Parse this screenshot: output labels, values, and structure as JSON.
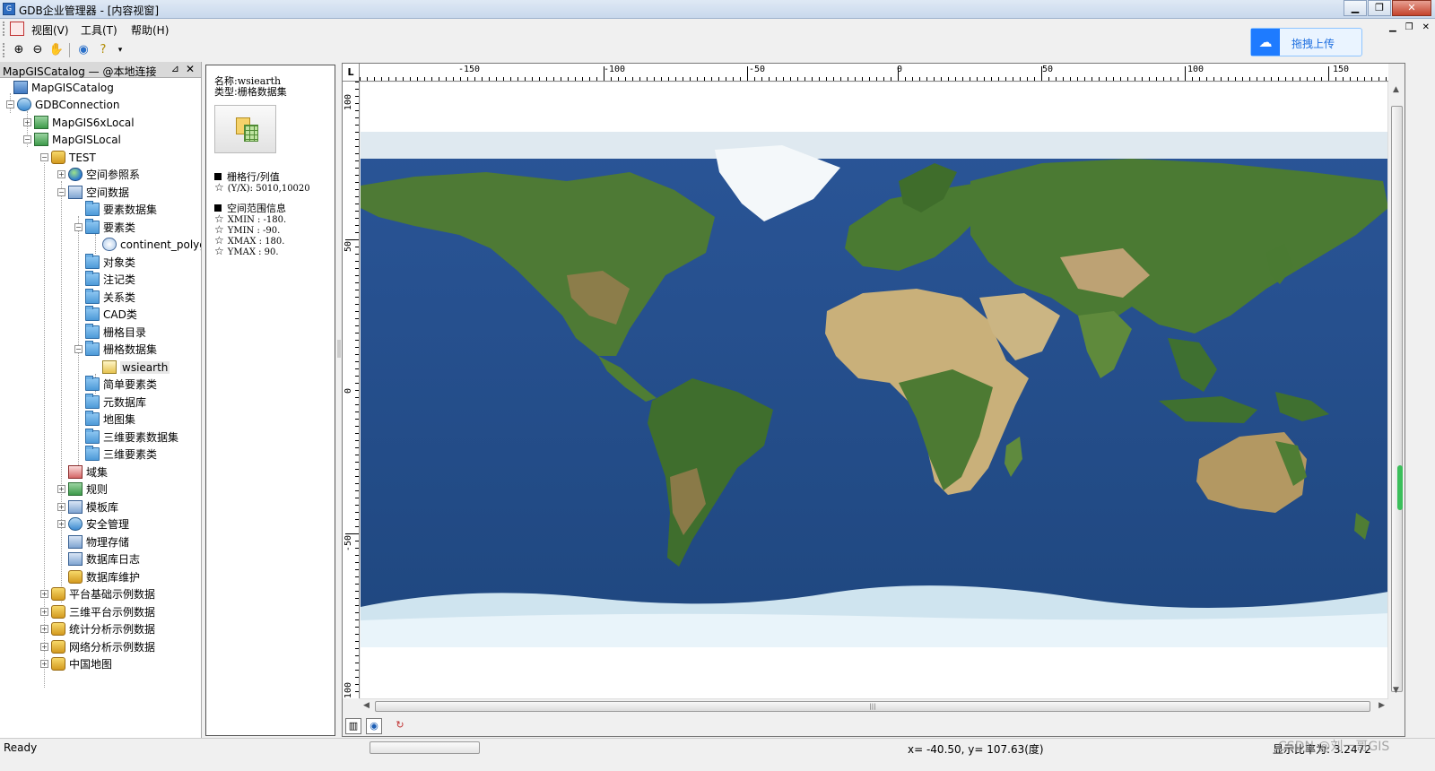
{
  "window": {
    "title": "GDB企业管理器 - [内容视窗]"
  },
  "menu": {
    "items": [
      "视图(V)",
      "工具(T)",
      "帮助(H)"
    ]
  },
  "upload": {
    "label": "拖拽上传"
  },
  "toolbar": {
    "buttons": [
      "zoom-in-icon",
      "zoom-out-icon",
      "pan-hand-icon",
      "globe-icon",
      "help-icon"
    ]
  },
  "catalog": {
    "title": "MapGISCatalog — @本地连接",
    "pin": "⊿",
    "close": "✕",
    "tree": [
      {
        "label": "MapGISCatalog"
      },
      {
        "label": "GDBConnection"
      },
      {
        "label": "MapGIS6xLocal"
      },
      {
        "label": "MapGISLocal"
      },
      {
        "label": "TEST"
      },
      {
        "label": "空间参照系"
      },
      {
        "label": "空间数据"
      },
      {
        "label": "要素数据集"
      },
      {
        "label": "要素类"
      },
      {
        "label": "continent_polyg"
      },
      {
        "label": "对象类"
      },
      {
        "label": "注记类"
      },
      {
        "label": "关系类"
      },
      {
        "label": "CAD类"
      },
      {
        "label": "栅格目录"
      },
      {
        "label": "栅格数据集"
      },
      {
        "label": "wsiearth"
      },
      {
        "label": "简单要素类"
      },
      {
        "label": "元数据库"
      },
      {
        "label": "地图集"
      },
      {
        "label": "三维要素数据集"
      },
      {
        "label": "三维要素类"
      },
      {
        "label": "域集"
      },
      {
        "label": "规则"
      },
      {
        "label": "模板库"
      },
      {
        "label": "安全管理"
      },
      {
        "label": "物理存储"
      },
      {
        "label": "数据库日志"
      },
      {
        "label": "数据库维护"
      },
      {
        "label": "平台基础示例数据"
      },
      {
        "label": "三维平台示例数据"
      },
      {
        "label": "统计分析示例数据"
      },
      {
        "label": "网络分析示例数据"
      },
      {
        "label": "中国地图"
      }
    ]
  },
  "info": {
    "name_line": "名称:wsiearth",
    "type_line": "类型:栅格数据集",
    "section1_title": "栅格行/列值",
    "section1_value": "(Y/X): 5010,10020",
    "section2_title": "空间范围信息",
    "xmin": "XMIN : -180.",
    "ymin": "YMIN : -90.",
    "xmax": "XMAX : 180.",
    "ymax": "YMAX : 90."
  },
  "map": {
    "corner": "L",
    "top_ticks": [
      "-150",
      "-100",
      "-50",
      "0",
      "50",
      "100",
      "150"
    ],
    "left_ticks": [
      "100",
      "50",
      "0",
      "-50",
      "-100"
    ],
    "ocean_color": "#24508f",
    "land_color": "#4e7a35",
    "desert_color": "#c9b07a",
    "ice_color": "#e8f2f8"
  },
  "status": {
    "ready": "Ready",
    "coords": "x= -40.50, y= 107.63(度)",
    "scale": "显示比率为:  3.2472"
  },
  "watermark": "CSDN @刘一哥GIS"
}
